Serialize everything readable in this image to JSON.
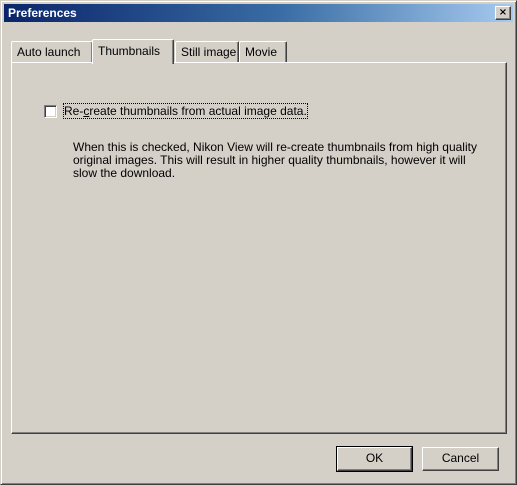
{
  "window": {
    "title": "Preferences",
    "close_glyph": "×"
  },
  "tabs": [
    {
      "label": "Auto launch",
      "active": false
    },
    {
      "label": "Thumbnails",
      "active": true
    },
    {
      "label": "Still image",
      "active": false
    },
    {
      "label": "Movie",
      "active": false
    }
  ],
  "panel": {
    "checkbox_label": "Re-create thumbnails from actual image data.",
    "checkbox_checked": false,
    "description": "When this is checked, Nikon View will re-create thumbnails from high quality original images. This will result in higher quality thumbnails, however it will slow the download."
  },
  "buttons": {
    "ok_label": "OK",
    "cancel_label": "Cancel"
  }
}
